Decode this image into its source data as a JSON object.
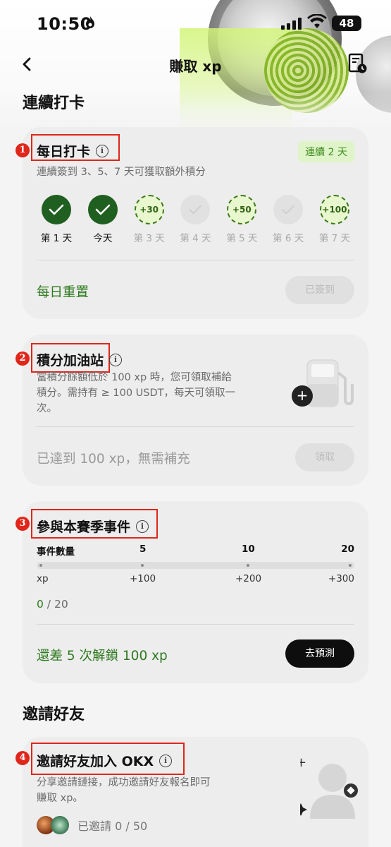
{
  "status_bar": {
    "time": "10:50",
    "battery": "48"
  },
  "nav": {
    "title": "賺取 xp"
  },
  "sections": {
    "checkin_title": "連續打卡",
    "invite_title": "邀請好友"
  },
  "daily_checkin": {
    "badge": "1",
    "title": "每日打卡",
    "streak_label": "連續 2 天",
    "subtitle": "連續簽到 3、5、7 天可獲取額外積分",
    "days": [
      {
        "label": "第 1 天",
        "state": "done",
        "reward": ""
      },
      {
        "label": "今天",
        "state": "done",
        "reward": ""
      },
      {
        "label": "第 3 天",
        "state": "bonus",
        "reward": "+30"
      },
      {
        "label": "第 4 天",
        "state": "empty",
        "reward": ""
      },
      {
        "label": "第 5 天",
        "state": "bonus",
        "reward": "+50"
      },
      {
        "label": "第 6 天",
        "state": "empty",
        "reward": ""
      },
      {
        "label": "第 7 天",
        "state": "bonus",
        "reward": "+100"
      }
    ],
    "reset_label": "每日重置",
    "button_label": "已簽到"
  },
  "fuel_station": {
    "badge": "2",
    "title": "積分加油站",
    "subtitle_line1": "當積分餘額低於 100 xp 時，您可領取補給",
    "subtitle_line2": "積分。需持有 ≥ 100 USDT，每天可領取一",
    "subtitle_line3": "次。",
    "status": "已達到 100 xp，無需補充",
    "button_label": "領取"
  },
  "season_events": {
    "badge": "3",
    "title": "參與本賽季事件",
    "row1": {
      "label": "事件數量",
      "m1": "5",
      "m2": "10",
      "m3": "20"
    },
    "row2": {
      "label": "xp",
      "m1": "+100",
      "m2": "+200",
      "m3": "+300"
    },
    "progress_current": "0",
    "progress_total": " / 20",
    "unlock_text": "還差 5 次解鎖 100 xp",
    "button_label": "去預測"
  },
  "invite": {
    "badge": "4",
    "title": "邀請好友加入 OKX",
    "subtitle_line1": "分享邀請鏈接，成功邀請好友報名即可",
    "subtitle_line2": "賺取 xp。",
    "invited_text": "已邀請 0 / 50"
  },
  "colors": {
    "accent_green": "#2f7a1f",
    "annotation_red": "#e0261a"
  }
}
